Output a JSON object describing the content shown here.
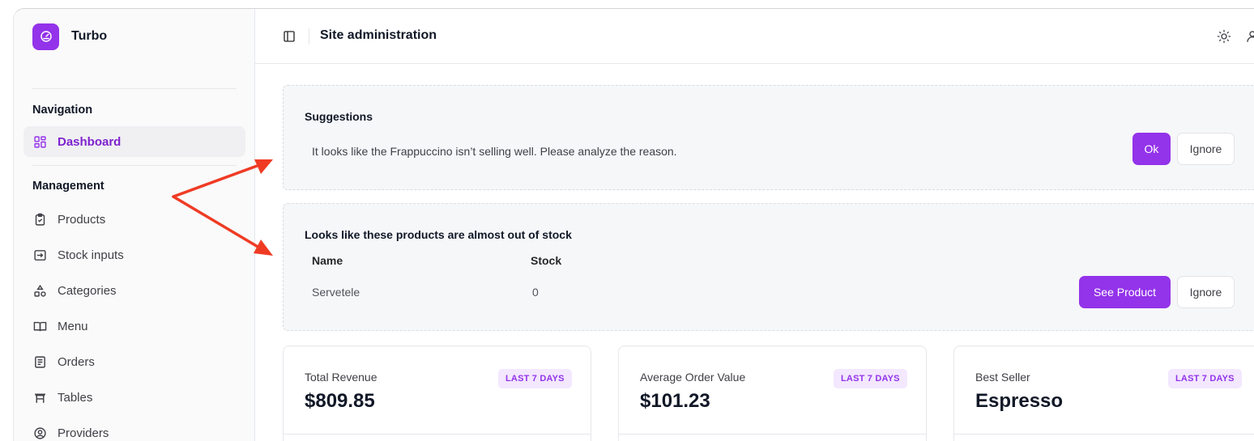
{
  "app": {
    "name": "Turbo"
  },
  "header": {
    "title": "Site administration"
  },
  "sidebar": {
    "sections": [
      {
        "label": "Navigation"
      },
      {
        "label": "Management"
      }
    ],
    "items": [
      {
        "label": "Dashboard",
        "icon": "dashboard-icon",
        "active": true
      },
      {
        "label": "Products",
        "icon": "clipboard-icon"
      },
      {
        "label": "Stock inputs",
        "icon": "stock-input-icon"
      },
      {
        "label": "Categories",
        "icon": "shapes-icon"
      },
      {
        "label": "Menu",
        "icon": "book-icon"
      },
      {
        "label": "Orders",
        "icon": "receipt-icon"
      },
      {
        "label": "Tables",
        "icon": "table-icon"
      },
      {
        "label": "Providers",
        "icon": "providers-icon"
      }
    ]
  },
  "suggestions": {
    "title": "Suggestions",
    "message": "It looks like the Frappuccino isn’t selling well. Please analyze the reason.",
    "ok_label": "Ok",
    "ignore_label": "Ignore"
  },
  "stock": {
    "title": "Looks like these products are almost out of stock",
    "columns": [
      "Name",
      "Stock"
    ],
    "rows": [
      {
        "name": "Servetele",
        "stock": "0"
      }
    ],
    "see_label": "See Product",
    "ignore_label": "Ignore"
  },
  "stats": [
    {
      "label": "Total Revenue",
      "value": "$809.85",
      "badge": "LAST 7 DAYS"
    },
    {
      "label": "Average Order Value",
      "value": "$101.23",
      "badge": "LAST 7 DAYS"
    },
    {
      "label": "Best Seller",
      "value": "Espresso",
      "badge": "LAST 7 DAYS"
    }
  ],
  "colors": {
    "accent": "#9333ea",
    "arrow": "#ef3b24"
  }
}
